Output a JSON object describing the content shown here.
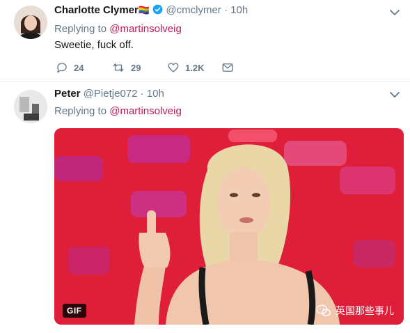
{
  "tweets": [
    {
      "name": "Charlotte Clymer",
      "name_emoji": "🏳️‍🌈",
      "handle": "@cmclymer",
      "time": "10h",
      "replying_prefix": "Replying to",
      "replying_to": "@martinsolveig",
      "text": "Sweetie, fuck off.",
      "replies": "24",
      "retweets": "29",
      "likes": "1.2K"
    },
    {
      "name": "Peter",
      "handle": "@Pietje072",
      "time": "10h",
      "replying_prefix": "Replying to",
      "replying_to": "@martinsolveig",
      "media_badge": "GIF",
      "watermark": "英国那些事儿"
    }
  ],
  "colors": {
    "mention": "#c0195a",
    "verified": "#1da1f2",
    "muted": "#657786",
    "media_background": "#e0213c"
  },
  "icons": [
    "verified-badge-icon",
    "chevron-down-icon",
    "reply-icon",
    "retweet-icon",
    "like-icon",
    "direct-message-icon",
    "wechat-icon"
  ]
}
